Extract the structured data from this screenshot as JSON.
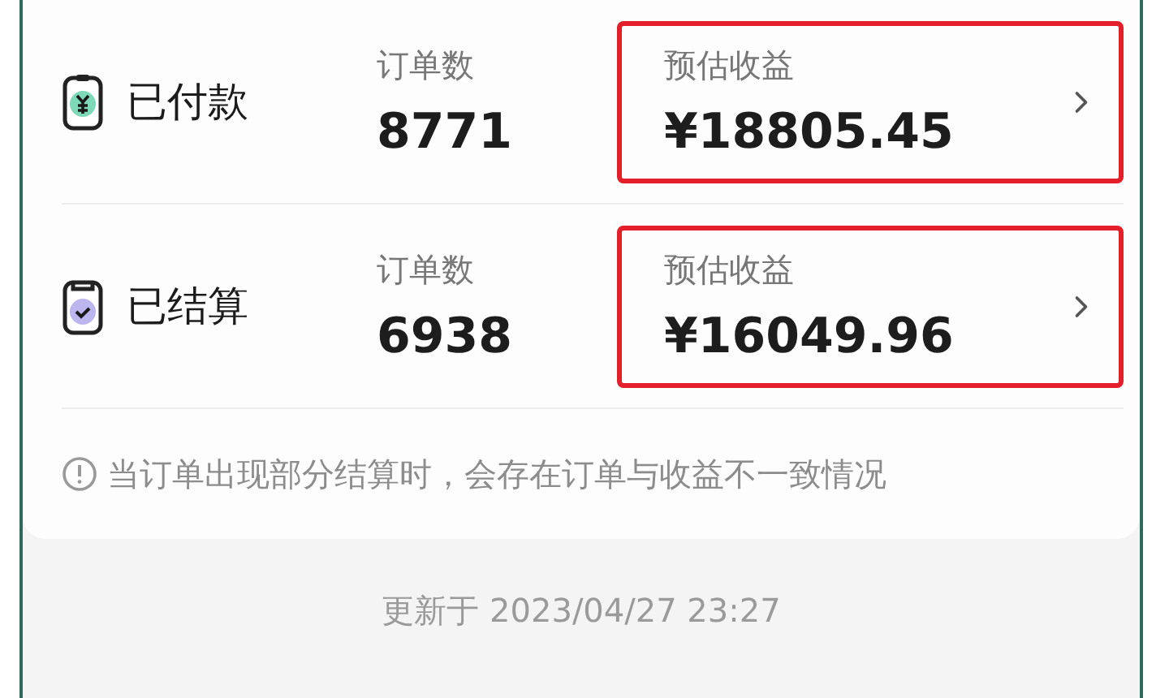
{
  "rows": [
    {
      "kind": "paid",
      "title": "已付款",
      "count_label": "订单数",
      "count": "8771",
      "income_label": "预估收益",
      "income": "¥18805.45",
      "highlighted": true
    },
    {
      "kind": "settled",
      "title": "已结算",
      "count_label": "订单数",
      "count": "6938",
      "income_label": "预估收益",
      "income": "¥16049.96",
      "highlighted": true
    }
  ],
  "note": "当订单出现部分结算时，会存在订单与收益不一致情况",
  "updated": "更新于 2023/04/27 23:27"
}
